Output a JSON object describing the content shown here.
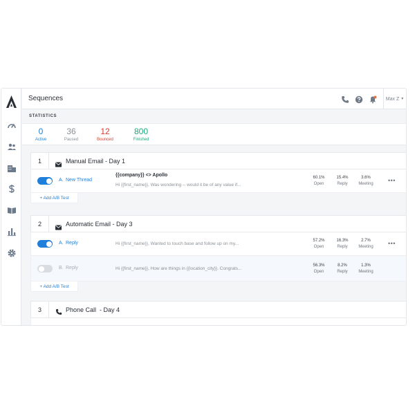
{
  "header": {
    "title": "Sequences",
    "user_label": "Max Z"
  },
  "icons": {
    "logo": "apollo-logo-icon",
    "nav": [
      "dashboard-icon",
      "people-icon",
      "companies-icon",
      "dollar-icon",
      "sequences-book-icon",
      "analytics-icon",
      "settings-icon"
    ],
    "header": [
      "phone-icon",
      "help-icon",
      "notifications-icon"
    ]
  },
  "colors": {
    "accent": "#1f7fdb",
    "bounced": "#d93b2b",
    "finished": "#1aab7a",
    "muted": "#8a9097"
  },
  "statistics": {
    "label": "STATISTICS",
    "items": [
      {
        "value": "0",
        "label": "Active"
      },
      {
        "value": "36",
        "label": "Paused"
      },
      {
        "value": "12",
        "label": "Bounced"
      },
      {
        "value": "800",
        "label": "Finished"
      }
    ]
  },
  "steps": [
    {
      "number": "1",
      "type_icon": "mail-icon",
      "name": "Manual Email - Day 1",
      "variants": [
        {
          "enabled": true,
          "letter": "A.",
          "name": "New Thread",
          "subject": "{{company}} <> Apollo",
          "preview": "Hi {{first_name}}, Was wondering -- would it be of any value if...",
          "metrics": [
            {
              "value": "60.1%",
              "label": "Open"
            },
            {
              "value": "15.4%",
              "label": "Reply"
            },
            {
              "value": "3.6%",
              "label": "Meeting"
            }
          ]
        }
      ],
      "add_ab_label": "+ Add A/B Test"
    },
    {
      "number": "2",
      "type_icon": "mail-icon",
      "name": "Automatic Email - Day 3",
      "variants": [
        {
          "enabled": true,
          "letter": "A.",
          "name": "Reply",
          "preview": "Hi {{first_name}}, Wanted to touch base and follow up on my...",
          "metrics": [
            {
              "value": "57.2%",
              "label": "Open"
            },
            {
              "value": "16.3%",
              "label": "Reply"
            },
            {
              "value": "2.7%",
              "label": "Meeting"
            }
          ]
        },
        {
          "enabled": false,
          "letter": "B.",
          "name": "Reply",
          "preview": "Hi {{first_name}}, How are things in {{location_city}}. Congrats...",
          "metrics": [
            {
              "value": "56.3%",
              "label": "Open"
            },
            {
              "value": "8.2%",
              "label": "Reply"
            },
            {
              "value": "1.3%",
              "label": "Meeting"
            }
          ]
        }
      ],
      "add_ab_label": "+ Add A/B Test"
    },
    {
      "number": "3",
      "type_icon": "phone-icon",
      "name": "Phone Call  - Day 4"
    }
  ]
}
